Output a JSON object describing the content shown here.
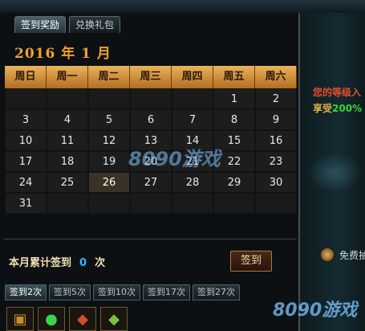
{
  "tabs": [
    "签到奖励",
    "兑换礼包"
  ],
  "calendar": {
    "title": "2016 年 1 月",
    "weekdays": [
      "周日",
      "周一",
      "周二",
      "周三",
      "周四",
      "周五",
      "周六"
    ],
    "leading_empty": 5,
    "days": [
      "1",
      "2",
      "3",
      "4",
      "5",
      "6",
      "7",
      "8",
      "9",
      "10",
      "11",
      "12",
      "13",
      "14",
      "15",
      "16",
      "17",
      "18",
      "19",
      "20",
      "21",
      "22",
      "23",
      "24",
      "25",
      "26",
      "27",
      "28",
      "29",
      "30",
      "31"
    ],
    "highlighted_day": "26"
  },
  "summary": {
    "label": "本月累计签到",
    "count": "0",
    "unit": "次"
  },
  "sign_button": "签到",
  "reward_tabs": [
    "签到2次",
    "签到5次",
    "签到10次",
    "签到17次",
    "签到27次"
  ],
  "reward_icons": [
    "chest-icon",
    "green-orb-icon",
    "red-scroll-icon",
    "green-scroll-icon"
  ],
  "right_panel": {
    "line1": "您的等级入",
    "line2_prefix": "享受",
    "line2_pct": "200%",
    "free_label": "免费抽"
  },
  "watermark": [
    "8090",
    "游戏"
  ],
  "colors": {
    "accent": "#f0a030",
    "count": "#39b0ff",
    "header": "#e9b35c"
  }
}
